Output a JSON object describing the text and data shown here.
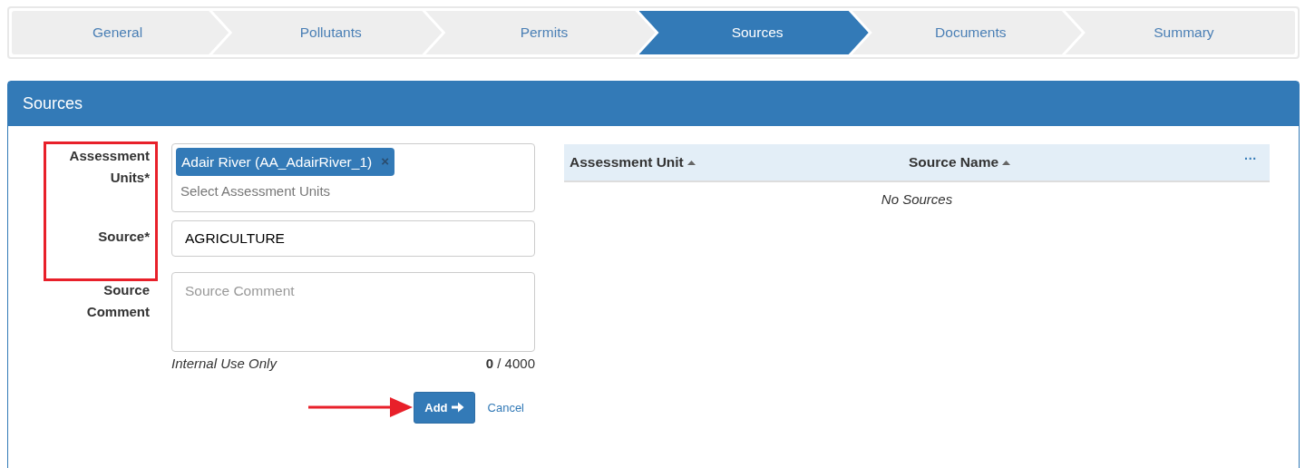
{
  "steps": [
    {
      "label": "General",
      "selected": false
    },
    {
      "label": "Pollutants",
      "selected": false
    },
    {
      "label": "Permits",
      "selected": false
    },
    {
      "label": "Sources",
      "selected": true
    },
    {
      "label": "Documents",
      "selected": false
    },
    {
      "label": "Summary",
      "selected": false
    }
  ],
  "panel": {
    "title": "Sources"
  },
  "form": {
    "assessment_units": {
      "label": "Assessment Units*",
      "tags": [
        {
          "label": "Adair River (AA_AdairRiver_1)",
          "remove": "×"
        }
      ],
      "placeholder": "Select Assessment Units"
    },
    "source": {
      "label": "Source*",
      "value": "AGRICULTURE"
    },
    "comment": {
      "label": "Source Comment",
      "placeholder": "Source Comment",
      "hint": "Internal Use Only",
      "count": "0",
      "max": "/ 4000"
    },
    "buttons": [
      {
        "kind": "primary",
        "label": "Add"
      },
      {
        "kind": "link",
        "label": "Cancel"
      }
    ]
  },
  "table": {
    "columns": [
      {
        "label": "Assessment Unit",
        "sorted": true
      },
      {
        "label": "Source Name",
        "sorted": true
      }
    ],
    "menu": "···",
    "empty": "No Sources"
  }
}
